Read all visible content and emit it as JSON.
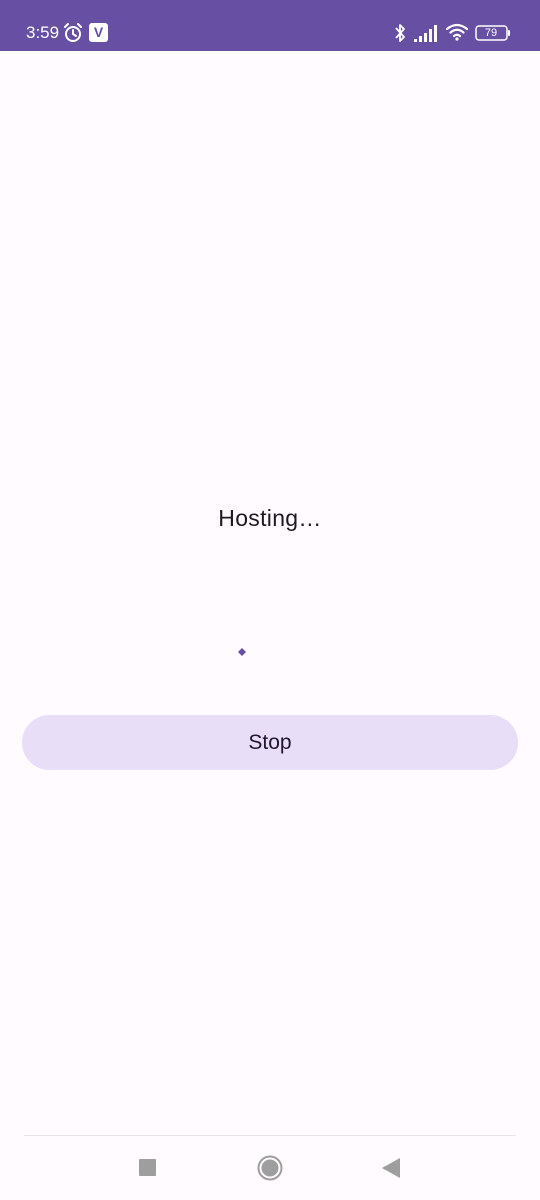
{
  "status_bar": {
    "time": "3:59",
    "app_badge": "V",
    "battery": "79",
    "icons": [
      "alarm-icon",
      "app-notification-icon",
      "bluetooth-icon",
      "signal-icon",
      "wifi-icon",
      "battery-icon"
    ],
    "color": "#6750a4"
  },
  "main": {
    "title": "Hosting…",
    "stop_label": "Stop",
    "accent": "#6750a4",
    "button_color": "#e8def8"
  },
  "nav_bar": {
    "icons": [
      "recents-icon",
      "home-icon",
      "back-icon"
    ]
  }
}
